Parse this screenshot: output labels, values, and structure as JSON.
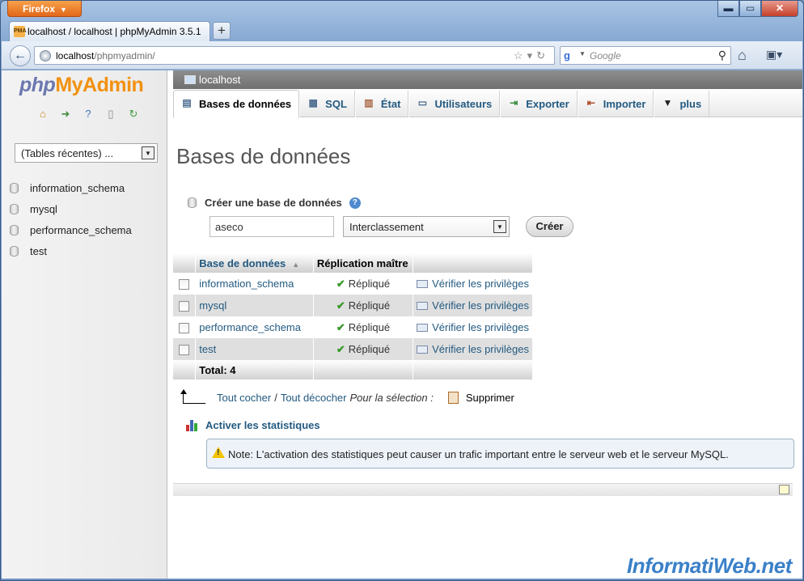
{
  "browser": {
    "menu_button": "Firefox",
    "tab_title": "localhost / localhost | phpMyAdmin 3.5.1",
    "favicon_text": "PMA",
    "url_host": "localhost",
    "url_path": "/phpmyadmin/",
    "search_placeholder": "Google"
  },
  "sidebar": {
    "logo_php": "php",
    "logo_myadmin": "MyAdmin",
    "recent_tables": "(Tables récentes) ...",
    "databases": [
      "information_schema",
      "mysql",
      "performance_schema",
      "test"
    ]
  },
  "server": {
    "label": "localhost"
  },
  "menu": {
    "tabs": [
      "Bases de données",
      "SQL",
      "État",
      "Utilisateurs",
      "Exporter",
      "Importer",
      "plus"
    ]
  },
  "page": {
    "title": "Bases de données",
    "create_label": "Créer une base de données",
    "db_name_value": "aseco",
    "collation_selected": "Interclassement",
    "create_button": "Créer"
  },
  "table": {
    "headers": [
      "Base de données",
      "Réplication maître"
    ],
    "rows": [
      {
        "name": "information_schema",
        "replication": "Répliqué",
        "privileges": "Vérifier les privilèges"
      },
      {
        "name": "mysql",
        "replication": "Répliqué",
        "privileges": "Vérifier les privilèges"
      },
      {
        "name": "performance_schema",
        "replication": "Répliqué",
        "privileges": "Vérifier les privilèges"
      },
      {
        "name": "test",
        "replication": "Répliqué",
        "privileges": "Vérifier les privilèges"
      }
    ],
    "total": "Total: 4"
  },
  "bulk": {
    "check_all": "Tout cocher",
    "separator": "/",
    "uncheck_all": "Tout décocher",
    "for_selection": "Pour la sélection :",
    "delete": "Supprimer"
  },
  "stats": {
    "enable_link": "Activer les statistiques",
    "note": "Note: L'activation des statistiques peut causer un trafic important entre le serveur web et le serveur MySQL."
  },
  "watermark": "InformatiWeb.net"
}
